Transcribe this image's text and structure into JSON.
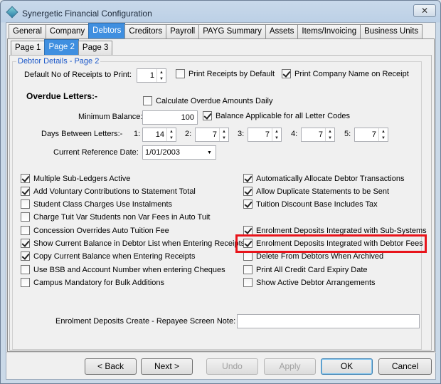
{
  "window": {
    "title": "Synergetic Financial Configuration",
    "close_label": "✕"
  },
  "main_tabs": [
    "General",
    "Company",
    "Debtors",
    "Creditors",
    "Payroll",
    "PAYG Summary",
    "Assets",
    "Items/Invoicing",
    "Business Units"
  ],
  "page_tabs": [
    "Page 1",
    "Page 2",
    "Page 3"
  ],
  "group": {
    "title": "Debtor Details  - Page 2"
  },
  "receipts": {
    "label": "Default No of Receipts to Print:",
    "value": "1",
    "print_by_default": "Print Receipts by Default",
    "print_company_name": "Print Company Name on Receipt"
  },
  "overdue": {
    "heading": "Overdue Letters:-",
    "calc_daily": "Calculate Overdue Amounts Daily",
    "min_balance_label": "Minimum Balance:",
    "min_balance_value": "100",
    "balance_applicable": "Balance Applicable for all Letter Codes",
    "days_label": "Days Between Letters:-",
    "days": [
      {
        "n": "1:",
        "v": "14"
      },
      {
        "n": "2:",
        "v": "7"
      },
      {
        "n": "3:",
        "v": "7"
      },
      {
        "n": "4:",
        "v": "7"
      },
      {
        "n": "5:",
        "v": "7"
      }
    ],
    "ref_date_label": "Current Reference Date:",
    "ref_date_value": "1/01/2003"
  },
  "left_options": [
    {
      "label": "Multiple Sub-Ledgers Active",
      "checked": true
    },
    {
      "label": "Add Voluntary Contributions to Statement Total",
      "checked": true
    },
    {
      "label": "Student Class Charges Use Instalments",
      "checked": false
    },
    {
      "label": "Charge Tuit Var Students non Var Fees in Auto Tuit",
      "checked": false
    },
    {
      "label": "Concession Overrides Auto Tuition Fee",
      "checked": false
    },
    {
      "label": "Show Current Balance in Debtor List when Entering Receipts",
      "checked": true
    },
    {
      "label": "Copy Current Balance when Entering Receipts",
      "checked": true
    },
    {
      "label": "Use BSB and Account Number when entering Cheques",
      "checked": false
    },
    {
      "label": "Campus Mandatory for Bulk Additions",
      "checked": false
    }
  ],
  "right_options": [
    {
      "label": "Automatically Allocate Debtor Transactions",
      "checked": true
    },
    {
      "label": "Allow Duplicate Statements to be Sent",
      "checked": true
    },
    {
      "label": "Tuition Discount Base Includes Tax",
      "checked": true
    },
    {
      "label": "Enrolment Deposits Integrated with Sub-Systems",
      "checked": true
    },
    {
      "label": "Enrolment Deposits Integrated with Debtor Fees",
      "checked": true
    },
    {
      "label": "Delete From Debtors When Archived",
      "checked": false
    },
    {
      "label": "Print All Credit Card Expiry Date",
      "checked": false
    },
    {
      "label": "Show Active Debtor Arrangements",
      "checked": false
    }
  ],
  "repayee": {
    "label": "Enrolment Deposits Create - Repayee Screen Note:",
    "value": ""
  },
  "buttons": {
    "back": "< Back",
    "next": "Next >",
    "undo": "Undo",
    "apply": "Apply",
    "ok": "OK",
    "cancel": "Cancel"
  }
}
